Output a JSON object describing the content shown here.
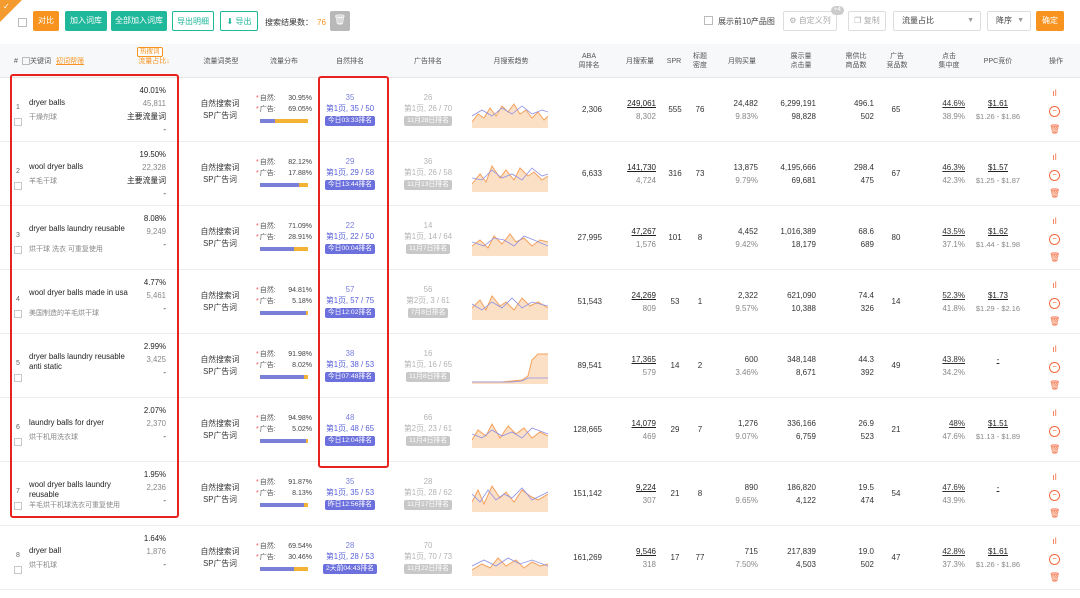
{
  "toolbar": {
    "corner_label": "✓",
    "compare": "对比",
    "add_to_lib": "加入词库",
    "add_all_to_lib": "全部加入词库",
    "export_detail": "导出明细",
    "export": "导出",
    "search_count_label": "搜索结果数：",
    "search_count_value": "76",
    "show_top10": "展示前10产品图",
    "custom_columns": "自定义列",
    "custom_columns_badge": "+4",
    "copy": "复制",
    "sort_field": "流量占比",
    "sort_order": "降序",
    "confirm": "确定"
  },
  "headers": {
    "index": "#",
    "keyword": "关键词",
    "keyword_sub": "初词帮筛",
    "hot_tag": "热搜词",
    "share": "流量占比↓",
    "type": "流量词类型",
    "dist": "流量分布",
    "natural": "自然排名",
    "ad": "广告排名",
    "trend": "月搜索趋势",
    "aba": "ABA\n周排名",
    "monthly": "月搜索量",
    "spr": "SPR",
    "title_density": "标题\n密度",
    "buy": "月购买量",
    "display": "展示量\n点击量",
    "supply": "需供比\n商品数",
    "ad_products": "广告\n竞品数",
    "click": "点击\n集中度",
    "ppc": "PPC竞价",
    "ops": "操作"
  },
  "flow_labels": {
    "natural": "自然:",
    "ad": "广告:"
  },
  "type_labels": {
    "search": "自然搜索词",
    "sp": "SP广告词"
  },
  "rows": [
    {
      "idx": "1",
      "kw": "dryer balls",
      "cn": "干燥剂球",
      "share": "40.01%",
      "vol": "45,811",
      "tag": "主要流量词",
      "dash": "-",
      "nat_pct": "30.95%",
      "ad_pct": "69.05%",
      "nat_frac": 0.31,
      "nat_rank": "35",
      "nat_pos": "第1页, 35 / 50",
      "nat_time": "今日03:33排名",
      "ad_rank": "26",
      "ad_pos": "第1页, 26 / 70",
      "ad_time": "11月28日排名",
      "aba": "2,306",
      "monthly": "249,061",
      "monthly_s": "8,302",
      "spr": "555",
      "td": "76",
      "buy": "24,482",
      "buy_s": "9.83%",
      "disp": "6,299,191",
      "disp_s": "98,828",
      "supply": "496.1",
      "supply_s": "502",
      "adprod": "65",
      "click": "44.6%",
      "click_s": "38.9%",
      "ppc": "$1.61",
      "ppc_s": "$1.26 - $1.86"
    },
    {
      "idx": "2",
      "kw": "wool dryer balls",
      "cn": "羊毛干球",
      "share": "19.50%",
      "vol": "22,328",
      "tag": "主要流量词",
      "dash": "-",
      "nat_pct": "82.12%",
      "ad_pct": "17.88%",
      "nat_frac": 0.82,
      "nat_rank": "29",
      "nat_pos": "第1页, 29 / 58",
      "nat_time": "今日13:44排名",
      "ad_rank": "36",
      "ad_pos": "第1页, 26 / 58",
      "ad_time": "11月13日排名",
      "aba": "6,633",
      "monthly": "141,730",
      "monthly_s": "4,724",
      "spr": "316",
      "td": "73",
      "buy": "13,875",
      "buy_s": "9.79%",
      "disp": "4,195,666",
      "disp_s": "69,681",
      "supply": "298.4",
      "supply_s": "475",
      "adprod": "67",
      "click": "46.3%",
      "click_s": "42.3%",
      "ppc": "$1.57",
      "ppc_s": "$1.25 - $1.87"
    },
    {
      "idx": "3",
      "kw": "dryer balls laundry reusable",
      "cn": "烘干球 洗衣 可重复使用",
      "share": "8.08%",
      "vol": "9,249",
      "tag": "",
      "dash": "-",
      "nat_pct": "71.09%",
      "ad_pct": "28.91%",
      "nat_frac": 0.71,
      "nat_rank": "22",
      "nat_pos": "第1页, 22 / 50",
      "nat_time": "今日00:04排名",
      "ad_rank": "14",
      "ad_pos": "第1页, 14 / 64",
      "ad_time": "11月7日排名",
      "aba": "27,995",
      "monthly": "47,267",
      "monthly_s": "1,576",
      "spr": "101",
      "td": "8",
      "buy": "4,452",
      "buy_s": "9.42%",
      "disp": "1,016,389",
      "disp_s": "18,179",
      "supply": "68.6",
      "supply_s": "689",
      "adprod": "80",
      "click": "43.5%",
      "click_s": "37.1%",
      "ppc": "$1.62",
      "ppc_s": "$1.44 - $1.98"
    },
    {
      "idx": "4",
      "kw": "wool dryer balls made in usa",
      "cn": "美国制造的羊毛烘干球",
      "share": "4.77%",
      "vol": "5,461",
      "tag": "",
      "dash": "-",
      "nat_pct": "94.81%",
      "ad_pct": "5.18%",
      "nat_frac": 0.95,
      "nat_rank": "57",
      "nat_pos": "第1页, 57 / 75",
      "nat_time": "今日12:02排名",
      "ad_rank": "56",
      "ad_pos": "第2页, 3 / 61",
      "ad_time": "7月8日排名",
      "aba": "51,543",
      "monthly": "24,269",
      "monthly_s": "809",
      "spr": "53",
      "td": "1",
      "buy": "2,322",
      "buy_s": "9.57%",
      "disp": "621,090",
      "disp_s": "10,388",
      "supply": "74.4",
      "supply_s": "326",
      "adprod": "14",
      "click": "52.3%",
      "click_s": "41.8%",
      "ppc": "$1.73",
      "ppc_s": "$1.29 - $2.16"
    },
    {
      "idx": "5",
      "kw": "dryer balls laundry reusable anti static",
      "cn": "",
      "share": "2.99%",
      "vol": "3,425",
      "tag": "",
      "dash": "-",
      "nat_pct": "91.98%",
      "ad_pct": "8.02%",
      "nat_frac": 0.92,
      "nat_rank": "38",
      "nat_pos": "第1页, 38 / 53",
      "nat_time": "今日07:48排名",
      "ad_rank": "16",
      "ad_pos": "第1页, 16 / 65",
      "ad_time": "11月8日排名",
      "aba": "89,541",
      "monthly": "17,365",
      "monthly_s": "579",
      "spr": "14",
      "td": "2",
      "buy": "600",
      "buy_s": "3.46%",
      "disp": "348,148",
      "disp_s": "8,671",
      "supply": "44.3",
      "supply_s": "392",
      "adprod": "49",
      "click": "43.8%",
      "click_s": "34.2%",
      "ppc": "-",
      "ppc_s": ""
    },
    {
      "idx": "6",
      "kw": "laundry balls for dryer",
      "cn": "烘干机用洗衣球",
      "share": "2.07%",
      "vol": "2,370",
      "tag": "",
      "dash": "-",
      "nat_pct": "94.98%",
      "ad_pct": "5.02%",
      "nat_frac": 0.95,
      "nat_rank": "48",
      "nat_pos": "第1页, 48 / 65",
      "nat_time": "今日12:04排名",
      "ad_rank": "66",
      "ad_pos": "第2页, 23 / 61",
      "ad_time": "11月4日排名",
      "aba": "128,665",
      "monthly": "14,079",
      "monthly_s": "469",
      "spr": "29",
      "td": "7",
      "buy": "1,276",
      "buy_s": "9.07%",
      "disp": "336,166",
      "disp_s": "6,759",
      "supply": "26.9",
      "supply_s": "523",
      "adprod": "21",
      "click": "48%",
      "click_s": "47.6%",
      "ppc": "$1.51",
      "ppc_s": "$1.13 - $1.89"
    },
    {
      "idx": "7",
      "kw": "wool dryer balls laundry reusable",
      "cn": "羊毛烘干机球洗衣可重复使用",
      "share": "1.95%",
      "vol": "2,236",
      "tag": "",
      "dash": "-",
      "nat_pct": "91.87%",
      "ad_pct": "8.13%",
      "nat_frac": 0.92,
      "nat_rank": "35",
      "nat_pos": "第1页, 35 / 53",
      "nat_time": "昨日12:56排名",
      "ad_rank": "28",
      "ad_pos": "第1页, 28 / 62",
      "ad_time": "11月17日排名",
      "aba": "151,142",
      "monthly": "9,224",
      "monthly_s": "307",
      "spr": "21",
      "td": "8",
      "buy": "890",
      "buy_s": "9.65%",
      "disp": "186,820",
      "disp_s": "4,122",
      "supply": "19.5",
      "supply_s": "474",
      "adprod": "54",
      "click": "47.6%",
      "click_s": "43.9%",
      "ppc": "-",
      "ppc_s": ""
    },
    {
      "idx": "8",
      "kw": "dryer ball",
      "cn": "烘干机球",
      "share": "1.64%",
      "vol": "1,876",
      "tag": "",
      "dash": "-",
      "nat_pct": "69.54%",
      "ad_pct": "30.46%",
      "nat_frac": 0.7,
      "nat_rank": "28",
      "nat_pos": "第1页, 28 / 53",
      "nat_time": "2天前04:43排名",
      "ad_rank": "70",
      "ad_pos": "第1页, 70 / 73",
      "ad_time": "11月22日排名",
      "aba": "161,269",
      "monthly": "9,546",
      "monthly_s": "318",
      "spr": "17",
      "td": "77",
      "buy": "715",
      "buy_s": "7.50%",
      "disp": "217,839",
      "disp_s": "4,503",
      "supply": "19.0",
      "supply_s": "502",
      "adprod": "47",
      "click": "42.8%",
      "click_s": "37.3%",
      "ppc": "$1.61",
      "ppc_s": "$1.26 - $1.86"
    }
  ],
  "colors": {
    "accent_orange": "#f7931e",
    "accent_green": "#1fb89a",
    "natural_rank": "#6b70dd",
    "highlight_red": "#e8231f",
    "trend_fill": "#f8c9a0",
    "trend_line_orange": "#f5a05a",
    "trend_line_purple": "#7b80e0"
  }
}
